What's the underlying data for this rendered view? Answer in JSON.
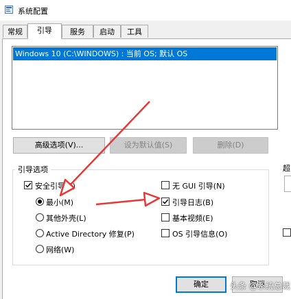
{
  "window": {
    "title": "系统配置"
  },
  "tabs": [
    {
      "label": "常规"
    },
    {
      "label": "引导"
    },
    {
      "label": "服务"
    },
    {
      "label": "启动"
    },
    {
      "label": "工具"
    }
  ],
  "os_list": {
    "items": [
      "Windows 10 (C:\\WINDOWS) : 当前 OS; 默认 OS"
    ]
  },
  "buttons": {
    "advanced": "高级选项(V)...",
    "set_default": "设为默认值(S)",
    "delete": "删除(D)",
    "ok": "确定",
    "cancel": "取消"
  },
  "boot_options": {
    "group_label": "引导选项",
    "safe_boot": {
      "label": "安全引导(F)",
      "checked": true
    },
    "modes": [
      {
        "label": "最小(M)",
        "selected": true
      },
      {
        "label": "其他外壳(L)",
        "selected": false
      },
      {
        "label": "Active Directory 修复(P)",
        "selected": false
      },
      {
        "label": "网络(W)",
        "selected": false
      }
    ],
    "no_gui": {
      "label": "无 GUI 引导(N)",
      "checked": false
    },
    "boot_log": {
      "label": "引导日志(B)",
      "checked": true
    },
    "base_video": {
      "label": "基本视频(E)",
      "checked": false
    },
    "os_boot_info": {
      "label": "OS 引导信息(O)",
      "checked": false
    }
  },
  "right_panel": {
    "label_clipped": "超"
  },
  "watermark": "头条 @系统总裁",
  "annotation_color": "#e53935"
}
